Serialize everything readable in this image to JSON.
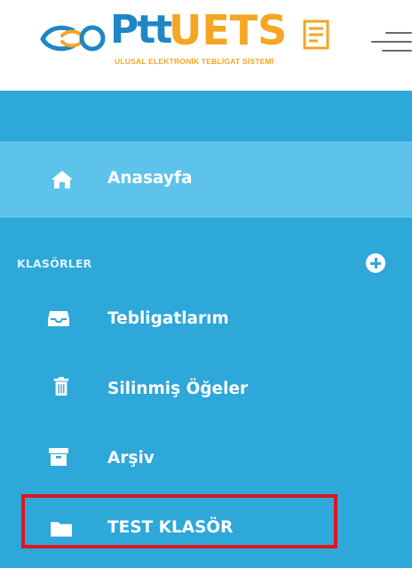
{
  "header": {
    "logo_ptt": "Ptt",
    "logo_uets": "UETS",
    "logo_subtitle": "ULUSAL ELEKTRONİK TEBLİGAT SİSTEMİ",
    "menu_icon": "hamburger-icon"
  },
  "sidebar": {
    "home": {
      "label": "Anasayfa",
      "icon": "home-icon"
    },
    "section_title": "KLASÖRLER",
    "add_icon": "plus-circle-icon",
    "items": [
      {
        "label": "Tebligatlarım",
        "icon": "inbox-icon"
      },
      {
        "label": "Silinmiş Öğeler",
        "icon": "trash-icon"
      },
      {
        "label": "Arşiv",
        "icon": "archive-icon"
      },
      {
        "label": "TEST KLASÖR",
        "icon": "folder-icon",
        "highlighted": true
      }
    ]
  },
  "colors": {
    "sidebar_bg": "#2ea7d9",
    "active_bg": "#5ec3ea",
    "logo_blue": "#1f86c6",
    "logo_orange": "#f5a623",
    "highlight_border": "#e2141a"
  }
}
